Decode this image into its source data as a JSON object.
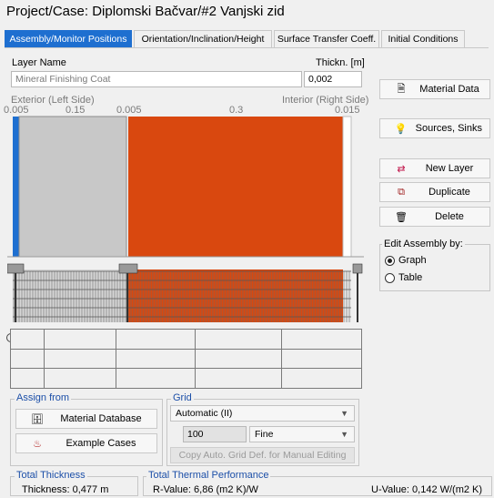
{
  "title": "Project/Case:  Diplomski Bačvar/#2 Vanjski zid",
  "tabs": [
    {
      "label": "Assembly/Monitor Positions",
      "active": true
    },
    {
      "label": "Orientation/Inclination/Height"
    },
    {
      "label": "Surface Transfer Coeff."
    },
    {
      "label": "Initial Conditions"
    }
  ],
  "layer": {
    "name_label": "Layer Name",
    "name_value": "Mineral Finishing Coat",
    "thick_label": "Thickn. [m]",
    "thick_value": "0,002"
  },
  "assembly": {
    "exterior_label": "Exterior (Left Side)",
    "interior_label": "Interior (Right Side)",
    "top_ticks": [
      "0.005",
      "0.15",
      "0.005",
      "0.3",
      "0.015"
    ],
    "colors": {
      "grey_layer": "#c8c8c8",
      "orange_layer": "#d9480f",
      "selected_blue": "#1e6fd0"
    }
  },
  "buttons": {
    "material_data": "Material Data",
    "sources_sinks": "Sources, Sinks",
    "new_layer": "New Layer",
    "duplicate": "Duplicate",
    "delete": "Delete"
  },
  "edit_by": {
    "label": "Edit Assembly by:",
    "graph": "Graph",
    "table": "Table",
    "selected": "Graph"
  },
  "assign": {
    "label": "Assign from",
    "material_db": "Material Database",
    "example_cases": "Example Cases"
  },
  "grid": {
    "label": "Grid",
    "mode": "Automatic (II)",
    "count": "100",
    "fineness": "Fine",
    "copy_btn": "Copy Auto. Grid Def. for Manual Editing"
  },
  "totals": {
    "thickness_label": "Total Thickness",
    "thickness_value": "Thickness: 0,477 m",
    "thermal_label": "Total Thermal Performance",
    "r_value": "R-Value: 6,86 (m2 K)/W",
    "u_value": "U-Value: 0,142 W/(m2 K)"
  }
}
